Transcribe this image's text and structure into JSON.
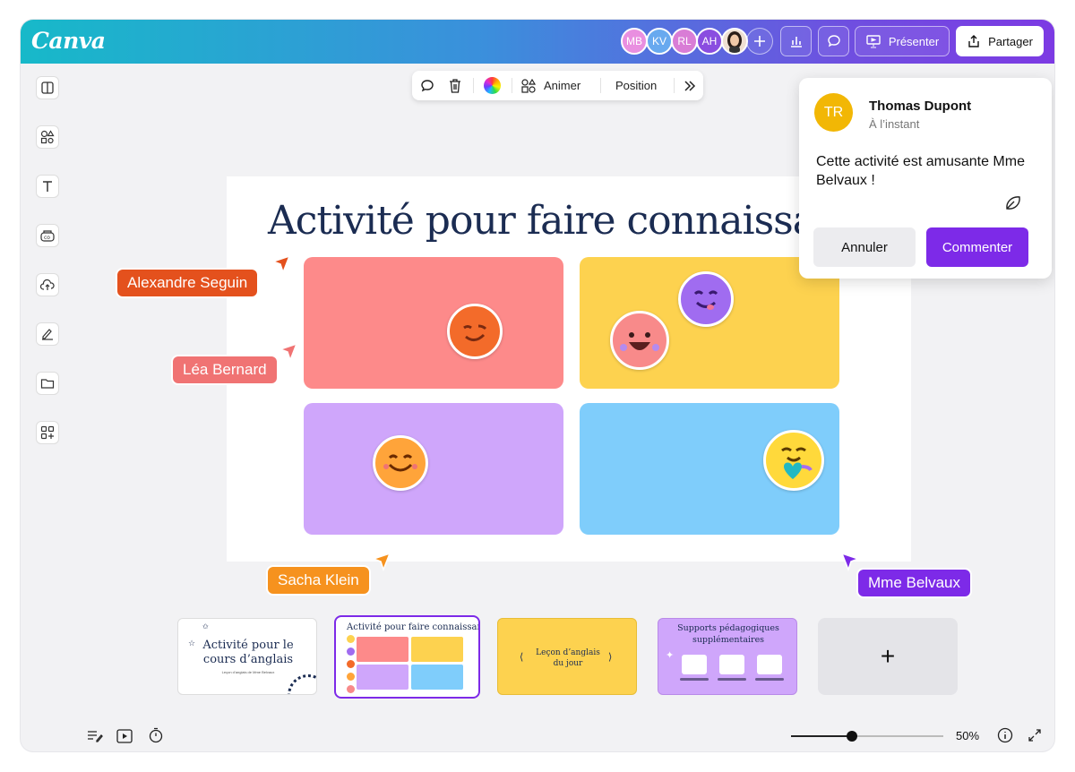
{
  "app": {
    "logo": "Canva"
  },
  "collaborators": [
    {
      "initials": "MB",
      "color": "#e98fe0"
    },
    {
      "initials": "KV",
      "color": "#68a9ef"
    },
    {
      "initials": "RL",
      "color": "#d97dd6"
    },
    {
      "initials": "AH",
      "color": "#8a4de0"
    }
  ],
  "header": {
    "present_label": "Présenter",
    "share_label": "Partager"
  },
  "sidebar_icons": [
    "layout-icon",
    "elements-icon",
    "text-icon",
    "brand-icon",
    "upload-icon",
    "draw-icon",
    "folder-icon",
    "apps-icon"
  ],
  "float_toolbar": {
    "animate_label": "Animer",
    "position_label": "Position"
  },
  "slide": {
    "title": "Activité pour faire connaissance",
    "cards": [
      {
        "name": "card-pink",
        "color": "#fd8a8a"
      },
      {
        "name": "card-yellow",
        "color": "#fdd24f"
      },
      {
        "name": "card-purple",
        "color": "#cfa6fb"
      },
      {
        "name": "card-blue",
        "color": "#7fcdfb"
      }
    ]
  },
  "cursors": [
    {
      "name": "Alexandre Seguin",
      "color": "#e4511d"
    },
    {
      "name": "Léa Bernard",
      "color": "#f07373"
    },
    {
      "name": "Sacha Klein",
      "color": "#f6921e"
    },
    {
      "name": "Mme Belvaux",
      "color": "#7d2ae8"
    }
  ],
  "comment": {
    "avatar_initials": "TR",
    "avatar_color": "#f2b705",
    "author": "Thomas Dupont",
    "time": "À l’instant",
    "text": "Cette activité est amusante Mme Belvaux !",
    "cancel_label": "Annuler",
    "submit_label": "Commenter"
  },
  "thumbnails": {
    "t1": {
      "title": "Activité pour le cours d’anglais",
      "subtitle": "Leçon d’anglais de Mme Belvaux"
    },
    "t2": {
      "title": "Activité pour faire connaissance"
    },
    "t3": {
      "title": "Leçon d’anglais du jour"
    },
    "t4": {
      "title": "Supports pédagogiques supplémentaires"
    },
    "add_label": "+"
  },
  "bottom": {
    "zoom": "50%",
    "zoom_level": 0.4
  }
}
